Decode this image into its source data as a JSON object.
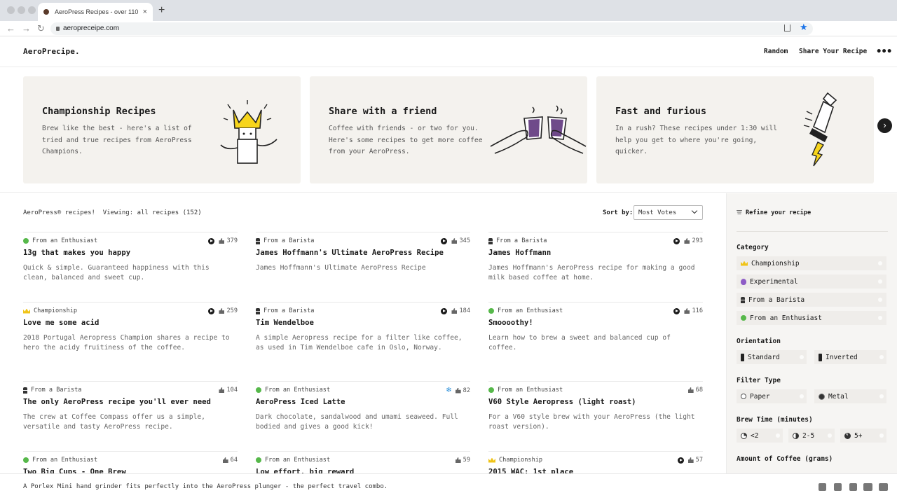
{
  "browser": {
    "tab_title": "AeroPress Recipes - over 110",
    "new_tab": "+",
    "tab_close": "×",
    "url": "aeropreceipe.com"
  },
  "site": {
    "logo": "AeroPrecipe.",
    "nav": {
      "random": "Random",
      "share": "Share Your Recipe",
      "more": "•••"
    }
  },
  "hero": [
    {
      "title": "Championship Recipes",
      "text": "Brew like the best - here's a list of tried and true recipes from AeroPress Champions."
    },
    {
      "title": "Share with a friend",
      "text": "Coffee with friends - or two for you. Here's some recipes to get more coffee from your AeroPress."
    },
    {
      "title": "Fast and furious",
      "text": "In a rush? These recipes under 1:30 will help you get to where you're going, quicker."
    }
  ],
  "listing": {
    "summary_prefix": "AeroPress® recipes!",
    "summary_view": "Viewing: all recipes (152)",
    "sort_label": "Sort by:",
    "sort_value": "Most Votes"
  },
  "recipes": [
    {
      "category": "From an Enthusiast",
      "cat_icon": "enthusiast",
      "video": true,
      "iced": false,
      "votes": "379",
      "title": "13g that makes you happy",
      "desc": "Quick & simple. Guaranteed happiness with this clean, balanced and sweet cup."
    },
    {
      "category": "From a Barista",
      "cat_icon": "barista",
      "video": true,
      "iced": false,
      "votes": "345",
      "title": "James Hoffmann's Ultimate AeroPress Recipe",
      "desc": "James Hoffmann's Ultimate AeroPress Recipe"
    },
    {
      "category": "From a Barista",
      "cat_icon": "barista",
      "video": true,
      "iced": false,
      "votes": "293",
      "title": "James Hoffmann",
      "desc": "James Hoffmann's AeroPress recipe for making a good milk based coffee at home."
    },
    {
      "category": "Championship",
      "cat_icon": "championship",
      "video": true,
      "iced": false,
      "votes": "259",
      "title": "Love me some acid",
      "desc": "2018 Portugal Aeropress Champion shares a recipe to hero the acidy fruitiness of the coffee."
    },
    {
      "category": "From a Barista",
      "cat_icon": "barista",
      "video": true,
      "iced": false,
      "votes": "184",
      "title": "Tim Wendelboe",
      "desc": "A simple Aeropress recipe for a filter like coffee, as used in Tim Wendelboe cafe in Oslo, Norway."
    },
    {
      "category": "From an Enthusiast",
      "cat_icon": "enthusiast",
      "video": true,
      "iced": false,
      "votes": "116",
      "title": "Smoooothy!",
      "desc": "Learn how to brew a sweet and balanced cup of coffee."
    },
    {
      "category": "From a Barista",
      "cat_icon": "barista",
      "video": false,
      "iced": false,
      "votes": "104",
      "title": "The only AeroPress recipe you'll ever need",
      "desc": "The crew at Coffee Compass offer us a simple, versatile and tasty AeroPress recipe."
    },
    {
      "category": "From an Enthusiast",
      "cat_icon": "enthusiast",
      "video": false,
      "iced": true,
      "votes": "82",
      "title": "AeroPress Iced Latte",
      "desc": "Dark chocolate, sandalwood and umami seaweed. Full bodied and gives a good kick!"
    },
    {
      "category": "From an Enthusiast",
      "cat_icon": "enthusiast",
      "video": false,
      "iced": false,
      "votes": "68",
      "title": "V60 Style Aeropress (light roast)",
      "desc": "For a V60 style brew with your AeroPress (the light roast version)."
    },
    {
      "category": "From an Enthusiast",
      "cat_icon": "enthusiast",
      "video": false,
      "iced": false,
      "votes": "64",
      "title": "Two Big Cups - One Brew",
      "desc": ""
    },
    {
      "category": "From an Enthusiast",
      "cat_icon": "enthusiast",
      "video": false,
      "iced": false,
      "votes": "59",
      "title": "Low effort, big reward",
      "desc": ""
    },
    {
      "category": "Championship",
      "cat_icon": "championship",
      "video": true,
      "iced": false,
      "votes": "57",
      "title": "2015 WAC: 1st place",
      "desc": ""
    }
  ],
  "sidebar": {
    "refine": "Refine your recipe",
    "category_head": "Category",
    "categories": [
      "Championship",
      "Experimental",
      "From a Barista",
      "From an Enthusiast"
    ],
    "orientation_head": "Orientation",
    "orientation": [
      "Standard",
      "Inverted"
    ],
    "filter_head": "Filter Type",
    "filters": [
      "Paper",
      "Metal"
    ],
    "brew_head": "Brew Time (minutes)",
    "brew": [
      "<2",
      "2-5",
      "5+"
    ],
    "amount_head": "Amount of Coffee (grams)"
  },
  "footer": {
    "tip": "A Porlex Mini hand grinder fits perfectly into the AeroPress plunger - the perfect travel combo."
  }
}
